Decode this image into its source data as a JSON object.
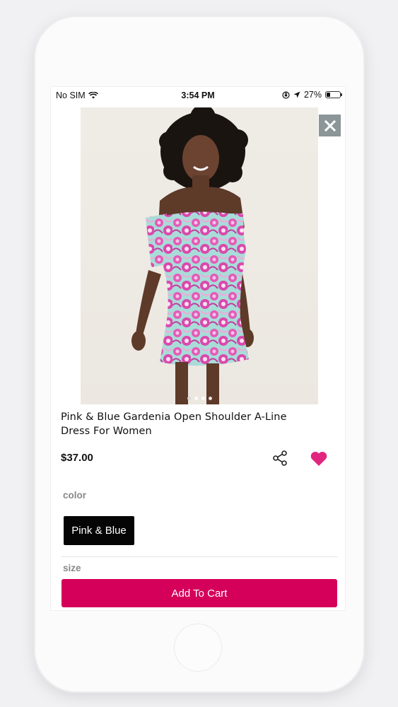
{
  "status_bar": {
    "carrier": "No SIM",
    "time": "3:54 PM",
    "battery": "27%",
    "battery_level": 0.27
  },
  "product": {
    "title": "Pink & Blue Gardenia Open Shoulder A-Line Dress For Women",
    "price": "$37.00",
    "image_dots": 4,
    "active_dot": 0
  },
  "options": {
    "color_label": "color",
    "color_value": "Pink & Blue",
    "size_label": "size"
  },
  "actions": {
    "add_to_cart": "Add To Cart"
  },
  "icons": {
    "close": "close-icon",
    "share": "share-icon",
    "favorite": "heart-icon"
  },
  "colors": {
    "accent": "#d5005a",
    "heart": "#e0267f",
    "close_bg": "#8c9597"
  }
}
